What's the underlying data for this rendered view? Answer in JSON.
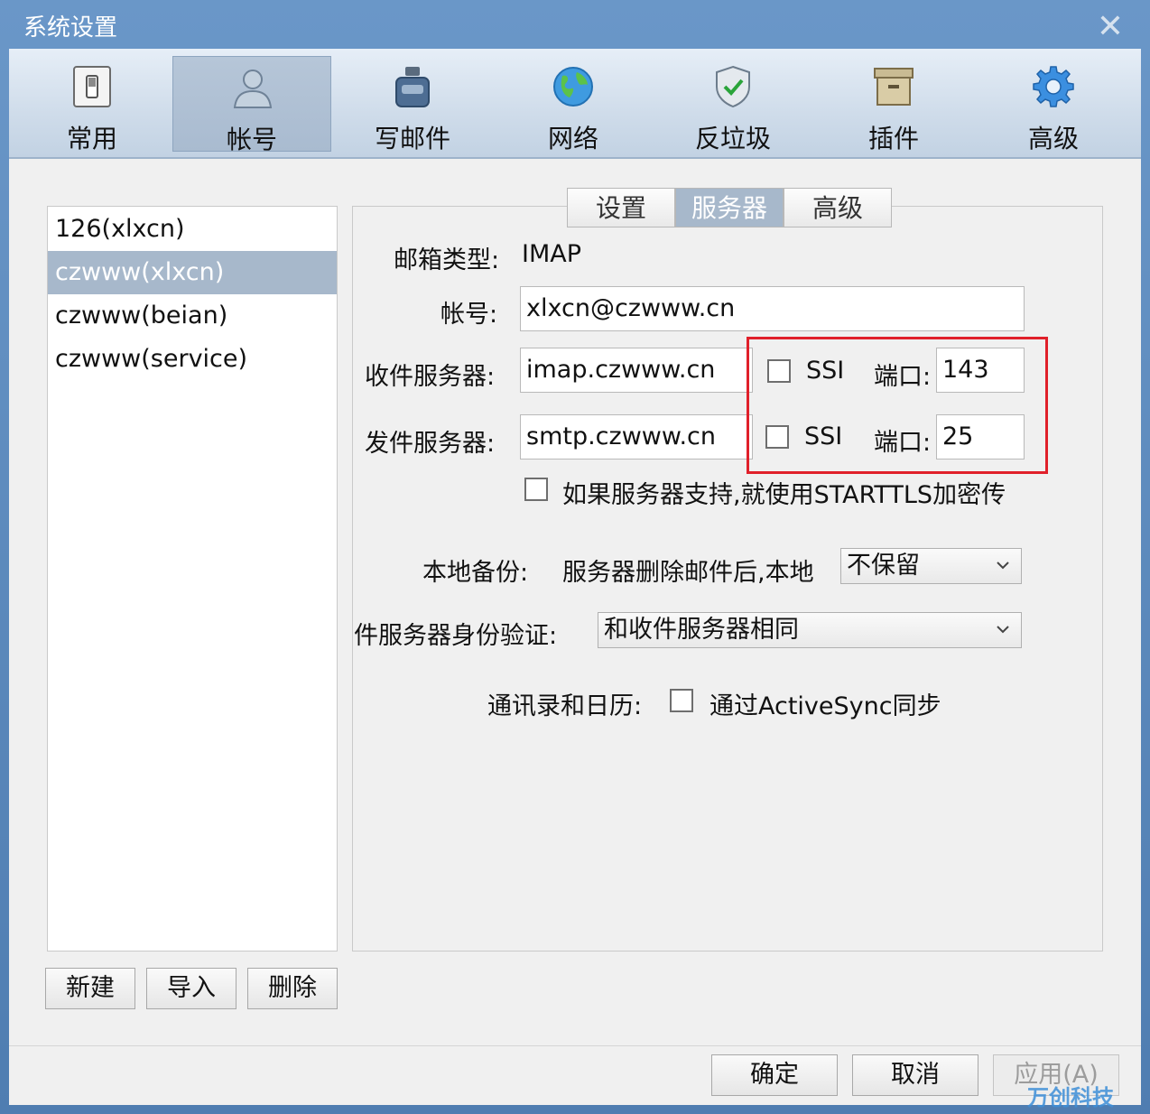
{
  "window": {
    "title": "系统设置",
    "close_symbol": "✕"
  },
  "toolbar": {
    "items": [
      {
        "label": "常用",
        "icon": "switch-icon"
      },
      {
        "label": "帐号",
        "icon": "user-icon"
      },
      {
        "label": "写邮件",
        "icon": "ink-bottle-icon"
      },
      {
        "label": "网络",
        "icon": "globe-icon"
      },
      {
        "label": "反垃圾",
        "icon": "shield-icon"
      },
      {
        "label": "插件",
        "icon": "archive-box-icon"
      },
      {
        "label": "高级",
        "icon": "gear-icon"
      }
    ],
    "active_index": 1
  },
  "accounts": {
    "items": [
      "126(xlxcn)",
      "czwww(xlxcn)",
      "czwww(beian)",
      "czwww(service)"
    ],
    "selected_index": 1,
    "buttons": {
      "new": "新建",
      "import": "导入",
      "delete": "删除"
    }
  },
  "tabs": {
    "items": [
      "设置",
      "服务器",
      "高级"
    ],
    "active_index": 1
  },
  "server": {
    "mailbox_type_label": "邮箱类型:",
    "mailbox_type_value": "IMAP",
    "account_label": "帐号:",
    "account_value": "xlxcn@czwww.cn",
    "incoming_label": "收件服务器:",
    "incoming_value": "imap.czwww.cn",
    "incoming_ssl_label": "SSI",
    "incoming_port_label": "端口:",
    "incoming_port_value": "143",
    "outgoing_label": "发件服务器:",
    "outgoing_value": "smtp.czwww.cn",
    "outgoing_ssl_label": "SSI",
    "outgoing_port_label": "端口:",
    "outgoing_port_value": "25",
    "starttls_label": "如果服务器支持,就使用STARTTLS加密传",
    "backup_label": "本地备份:",
    "backup_text": "服务器删除邮件后,本地",
    "backup_option": "不保留",
    "auth_label": "件服务器身份验证:",
    "auth_option": "和收件服务器相同",
    "contacts_label": "通讯录和日历:",
    "activesync_label": "通过ActiveSync同步"
  },
  "footer": {
    "ok": "确定",
    "cancel": "取消",
    "apply": "应用(A)"
  },
  "watermark": "万创科技",
  "colors": {
    "highlight": "#e0202a",
    "selected": "#a7b8cb",
    "titlebar": "#5b87b8"
  }
}
